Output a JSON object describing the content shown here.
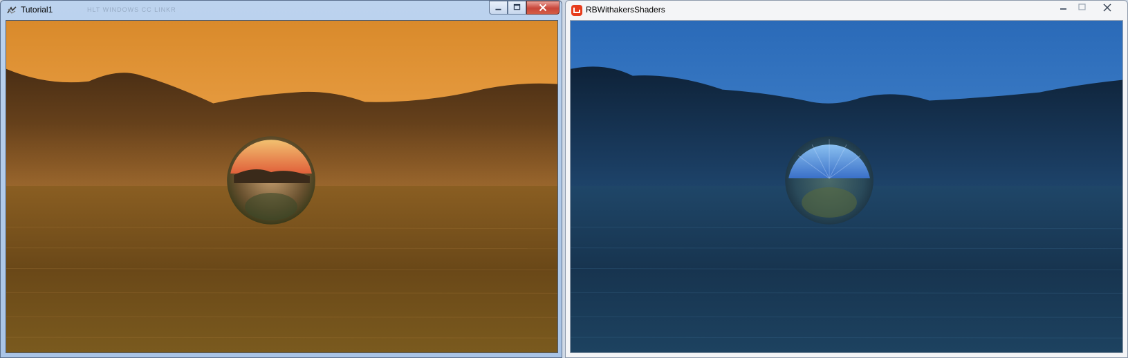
{
  "windows": [
    {
      "title": "Tutorial1",
      "icon": "xna-app-icon",
      "theme": "sunset",
      "ghost_text": "HLT WINDOWS CC LINKR",
      "controls": [
        "minimize",
        "maximize",
        "close"
      ]
    },
    {
      "title": "RBWithakersShaders",
      "icon": "monogame-icon",
      "theme": "night",
      "controls": [
        "minimize",
        "maximize",
        "close"
      ]
    }
  ],
  "colors": {
    "sunset_sky_top": "#d98a2b",
    "sunset_sky_mid": "#f0a850",
    "sunset_water": "#6a4818",
    "night_sky_top": "#2a6ab8",
    "night_sky_mid": "#4a8ad0",
    "night_water": "#17344f",
    "monogame_red": "#e73c1c"
  }
}
